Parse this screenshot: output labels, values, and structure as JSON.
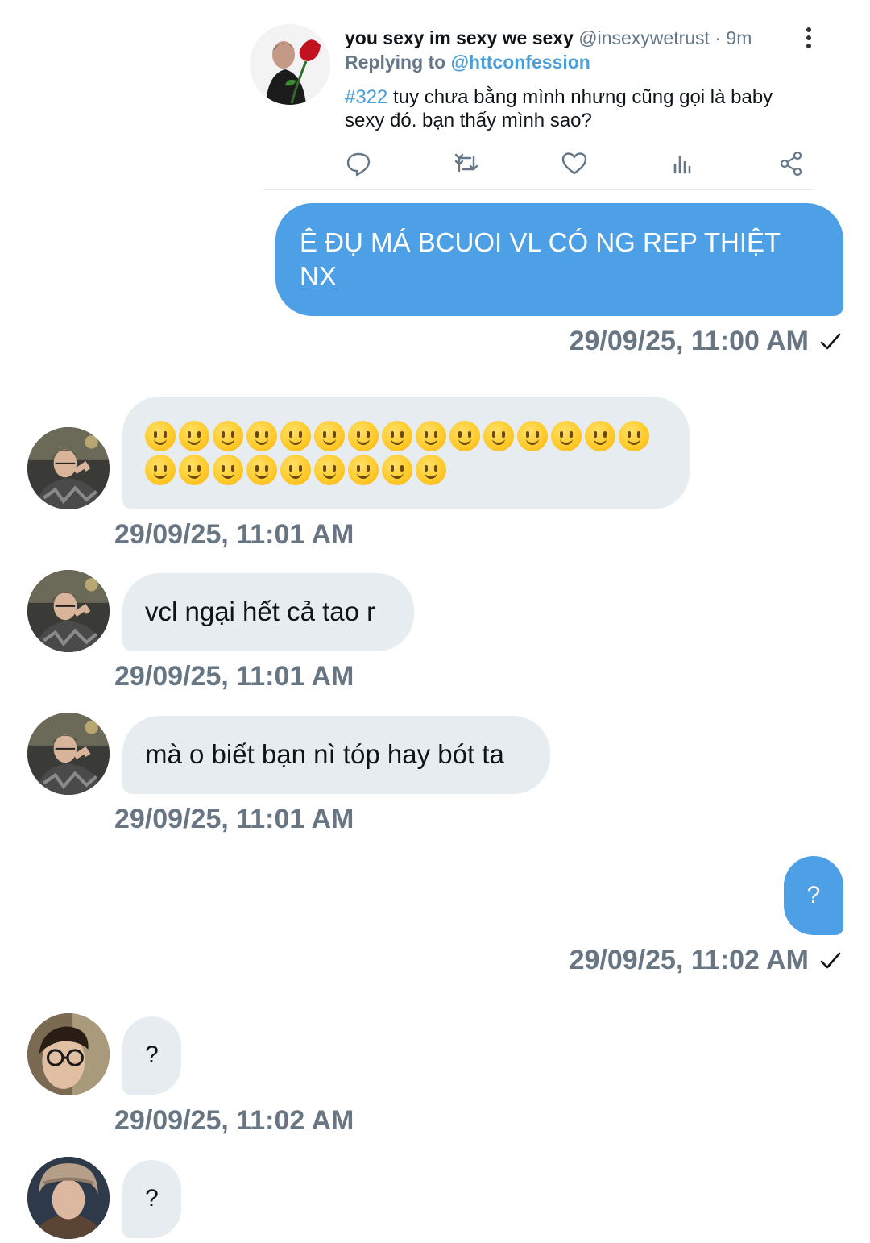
{
  "tweet": {
    "author_name": "you sexy im sexy we sexy",
    "author_handle": "@insexywetrust",
    "separator": " · ",
    "time_ago": "9m",
    "replying_label": "Replying to",
    "replying_to": "@httconfession",
    "hashtag": "#322",
    "text": " tuy chưa bằng mình nhưng cũng gọi là baby sexy đó. bạn thấy mình sao?",
    "actions": [
      "reply-icon",
      "retweet-icon",
      "like-icon",
      "analytics-icon",
      "share-icon"
    ]
  },
  "messages": [
    {
      "direction": "sent",
      "text": "Ê ĐỤ MÁ BCUOI VL CÓ NG REP THIỆT NX",
      "timestamp": "29/09/25, 11:00 AM",
      "read": true
    },
    {
      "direction": "received",
      "emoji": "slightly-smiling-face",
      "emoji_count": 24,
      "timestamp": "29/09/25, 11:01 AM"
    },
    {
      "direction": "received",
      "text": "vcl ngại hết cả tao r",
      "timestamp": "29/09/25, 11:01 AM"
    },
    {
      "direction": "received",
      "text": "mà o biết bạn nì tóp hay bót ta",
      "timestamp": "29/09/25, 11:01 AM"
    },
    {
      "direction": "sent",
      "text": "?",
      "timestamp": "29/09/25, 11:02 AM",
      "read": true
    },
    {
      "direction": "received",
      "text": "?",
      "timestamp": "29/09/25, 11:02 AM"
    },
    {
      "direction": "received",
      "text": "?"
    }
  ],
  "colors": {
    "sent_bubble": "#4d9fe6",
    "received_bubble": "#e7ecf0",
    "timestamp": "#687683",
    "link": "#4b9ed6"
  }
}
